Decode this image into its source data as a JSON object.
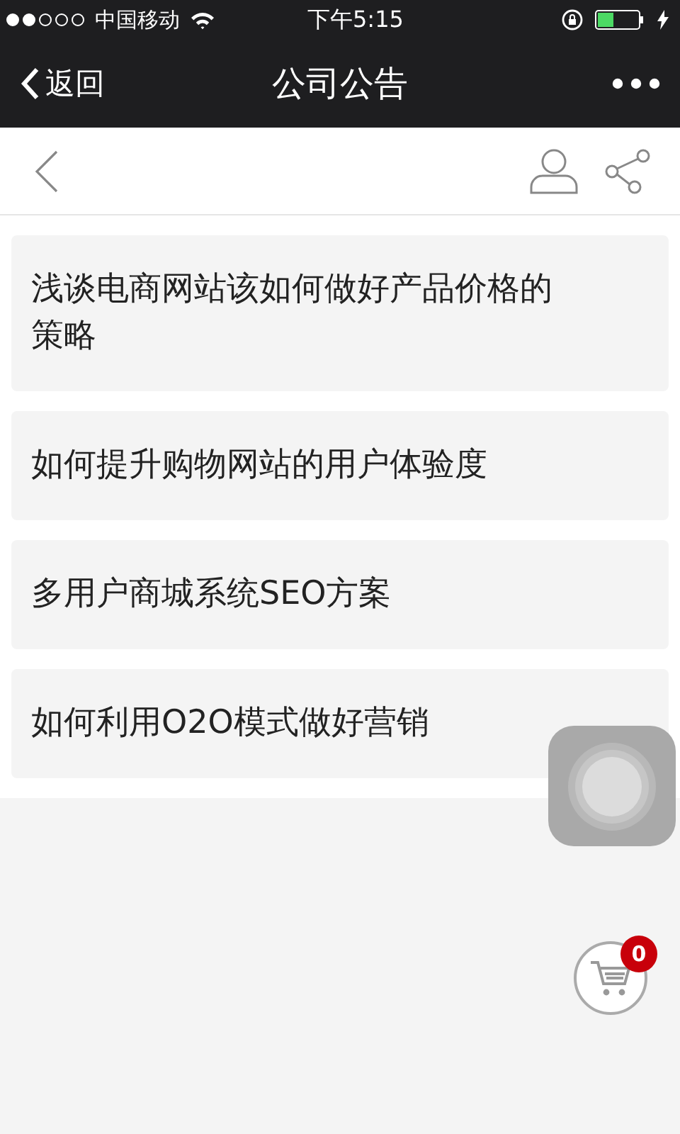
{
  "status_bar": {
    "carrier": "中国移动",
    "time": "下午5:15"
  },
  "nav_bar": {
    "back_label": "返回",
    "title": "公司公告"
  },
  "articles": [
    {
      "title": "浅谈电商网站该如何做好产品价格的策略"
    },
    {
      "title": "如何提升购物网站的用户体验度"
    },
    {
      "title": "多用户商城系统SEO方案"
    },
    {
      "title": "如何利用O2O模式做好营销"
    }
  ],
  "cart": {
    "count": "0"
  }
}
